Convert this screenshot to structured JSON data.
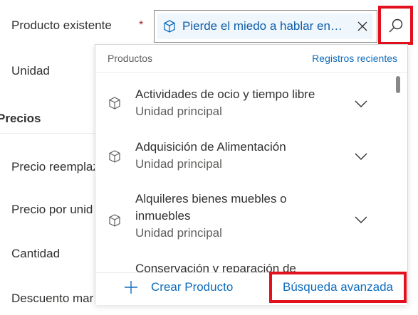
{
  "form": {
    "producto_label": "Producto existente",
    "required_mark": "*",
    "unidad_label": "Unidad",
    "precios_section": "Precios",
    "precio_reemplazo_label": "Precio reemplaz",
    "precio_unidad_label": "Precio por unid",
    "cantidad_label": "Cantidad",
    "descuento_label": "Descuento mar"
  },
  "lookup": {
    "selected_value": "Pierde el miedo a hablar en…",
    "chip_icon": "product-cube-icon",
    "clear_icon": "close-icon",
    "search_icon": "search-icon"
  },
  "dropdown": {
    "header_left": "Productos",
    "header_right": "Registros recientes",
    "items": [
      {
        "title": "Actividades de ocio y tiempo libre",
        "subtitle": "Unidad principal"
      },
      {
        "title": "Adquisición de Alimentación",
        "subtitle": "Unidad principal"
      },
      {
        "title": "Alquileres bienes muebles o inmuebles",
        "subtitle": "Unidad principal"
      },
      {
        "title": "Conservación y reparación de",
        "subtitle": ""
      }
    ],
    "create_label": "Crear Producto",
    "advanced_label": "Búsqueda avanzada"
  },
  "colors": {
    "accent": "#0f6cbd",
    "highlight_border": "#e3101e",
    "chip_bg": "#eff6fc"
  }
}
